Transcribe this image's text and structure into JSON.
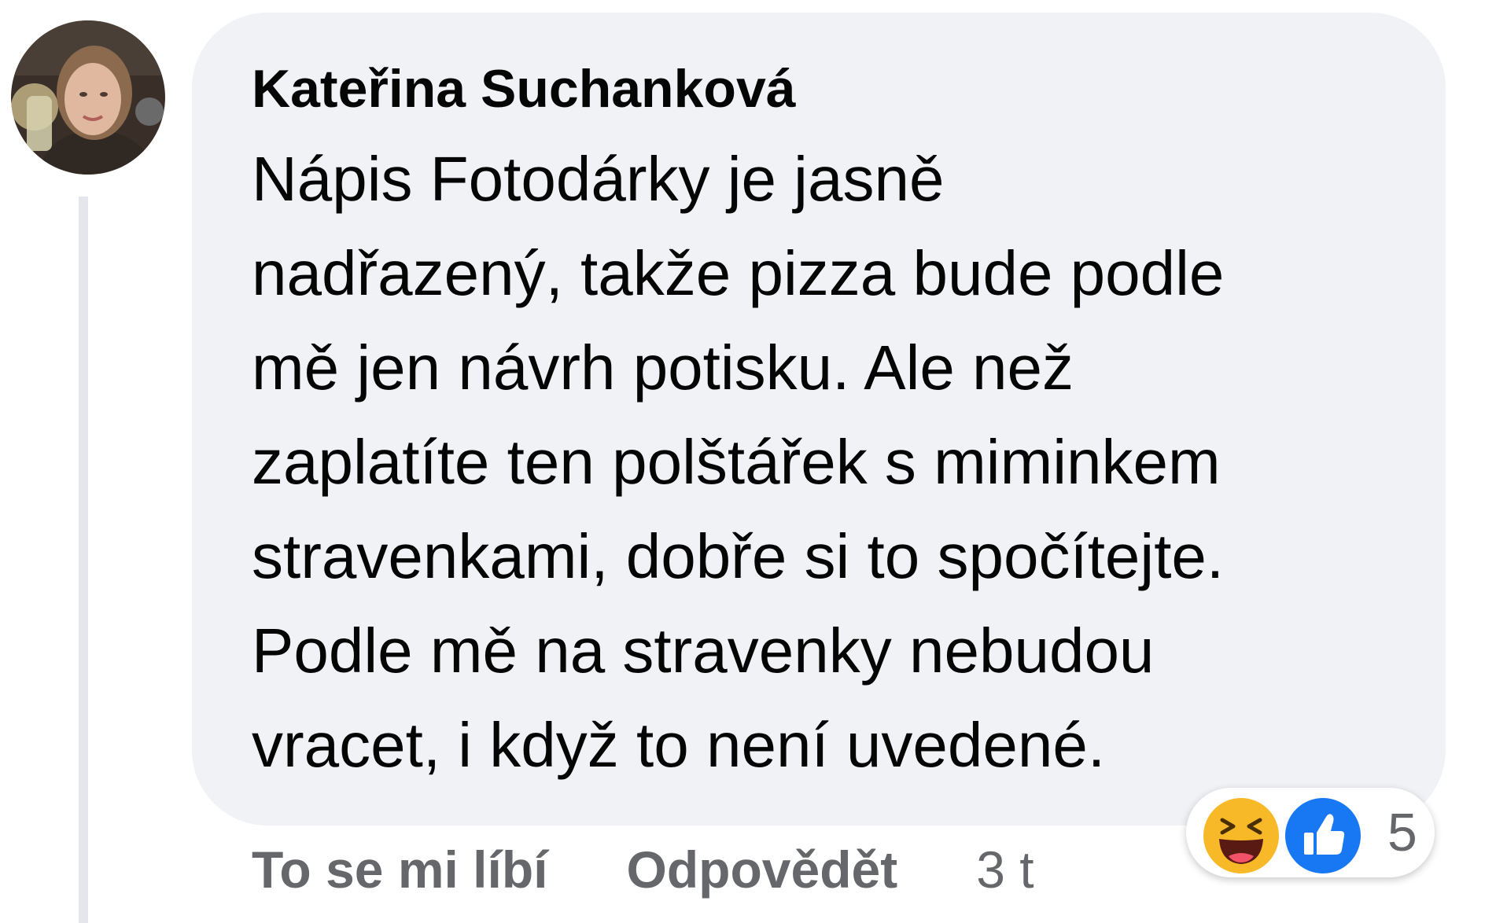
{
  "comment": {
    "author": "Kateřina Suchanková",
    "body_lines": [
      "Nápis Fotodárky je jasně",
      "nadřazený, takže pizza bude podle",
      "mě jen návrh potisku. Ale než",
      "zaplatíte ten polštářek s miminkem",
      "stravenkami, dobře si to spočítejte.",
      "Podle mě na stravenky nebudou",
      "vracet, i když to není uvedené."
    ]
  },
  "actions": {
    "like_label": "To se mi líbí",
    "reply_label": "Odpovědět",
    "timestamp": "3 t"
  },
  "reactions": {
    "icons": [
      "haha-icon",
      "like-icon"
    ],
    "count": "5"
  },
  "colors": {
    "bubble": "#f0f2f5",
    "text": "#050505",
    "secondary_text": "#65676b",
    "like_blue": "#1877f2",
    "haha_yellow": "#f7b928"
  }
}
